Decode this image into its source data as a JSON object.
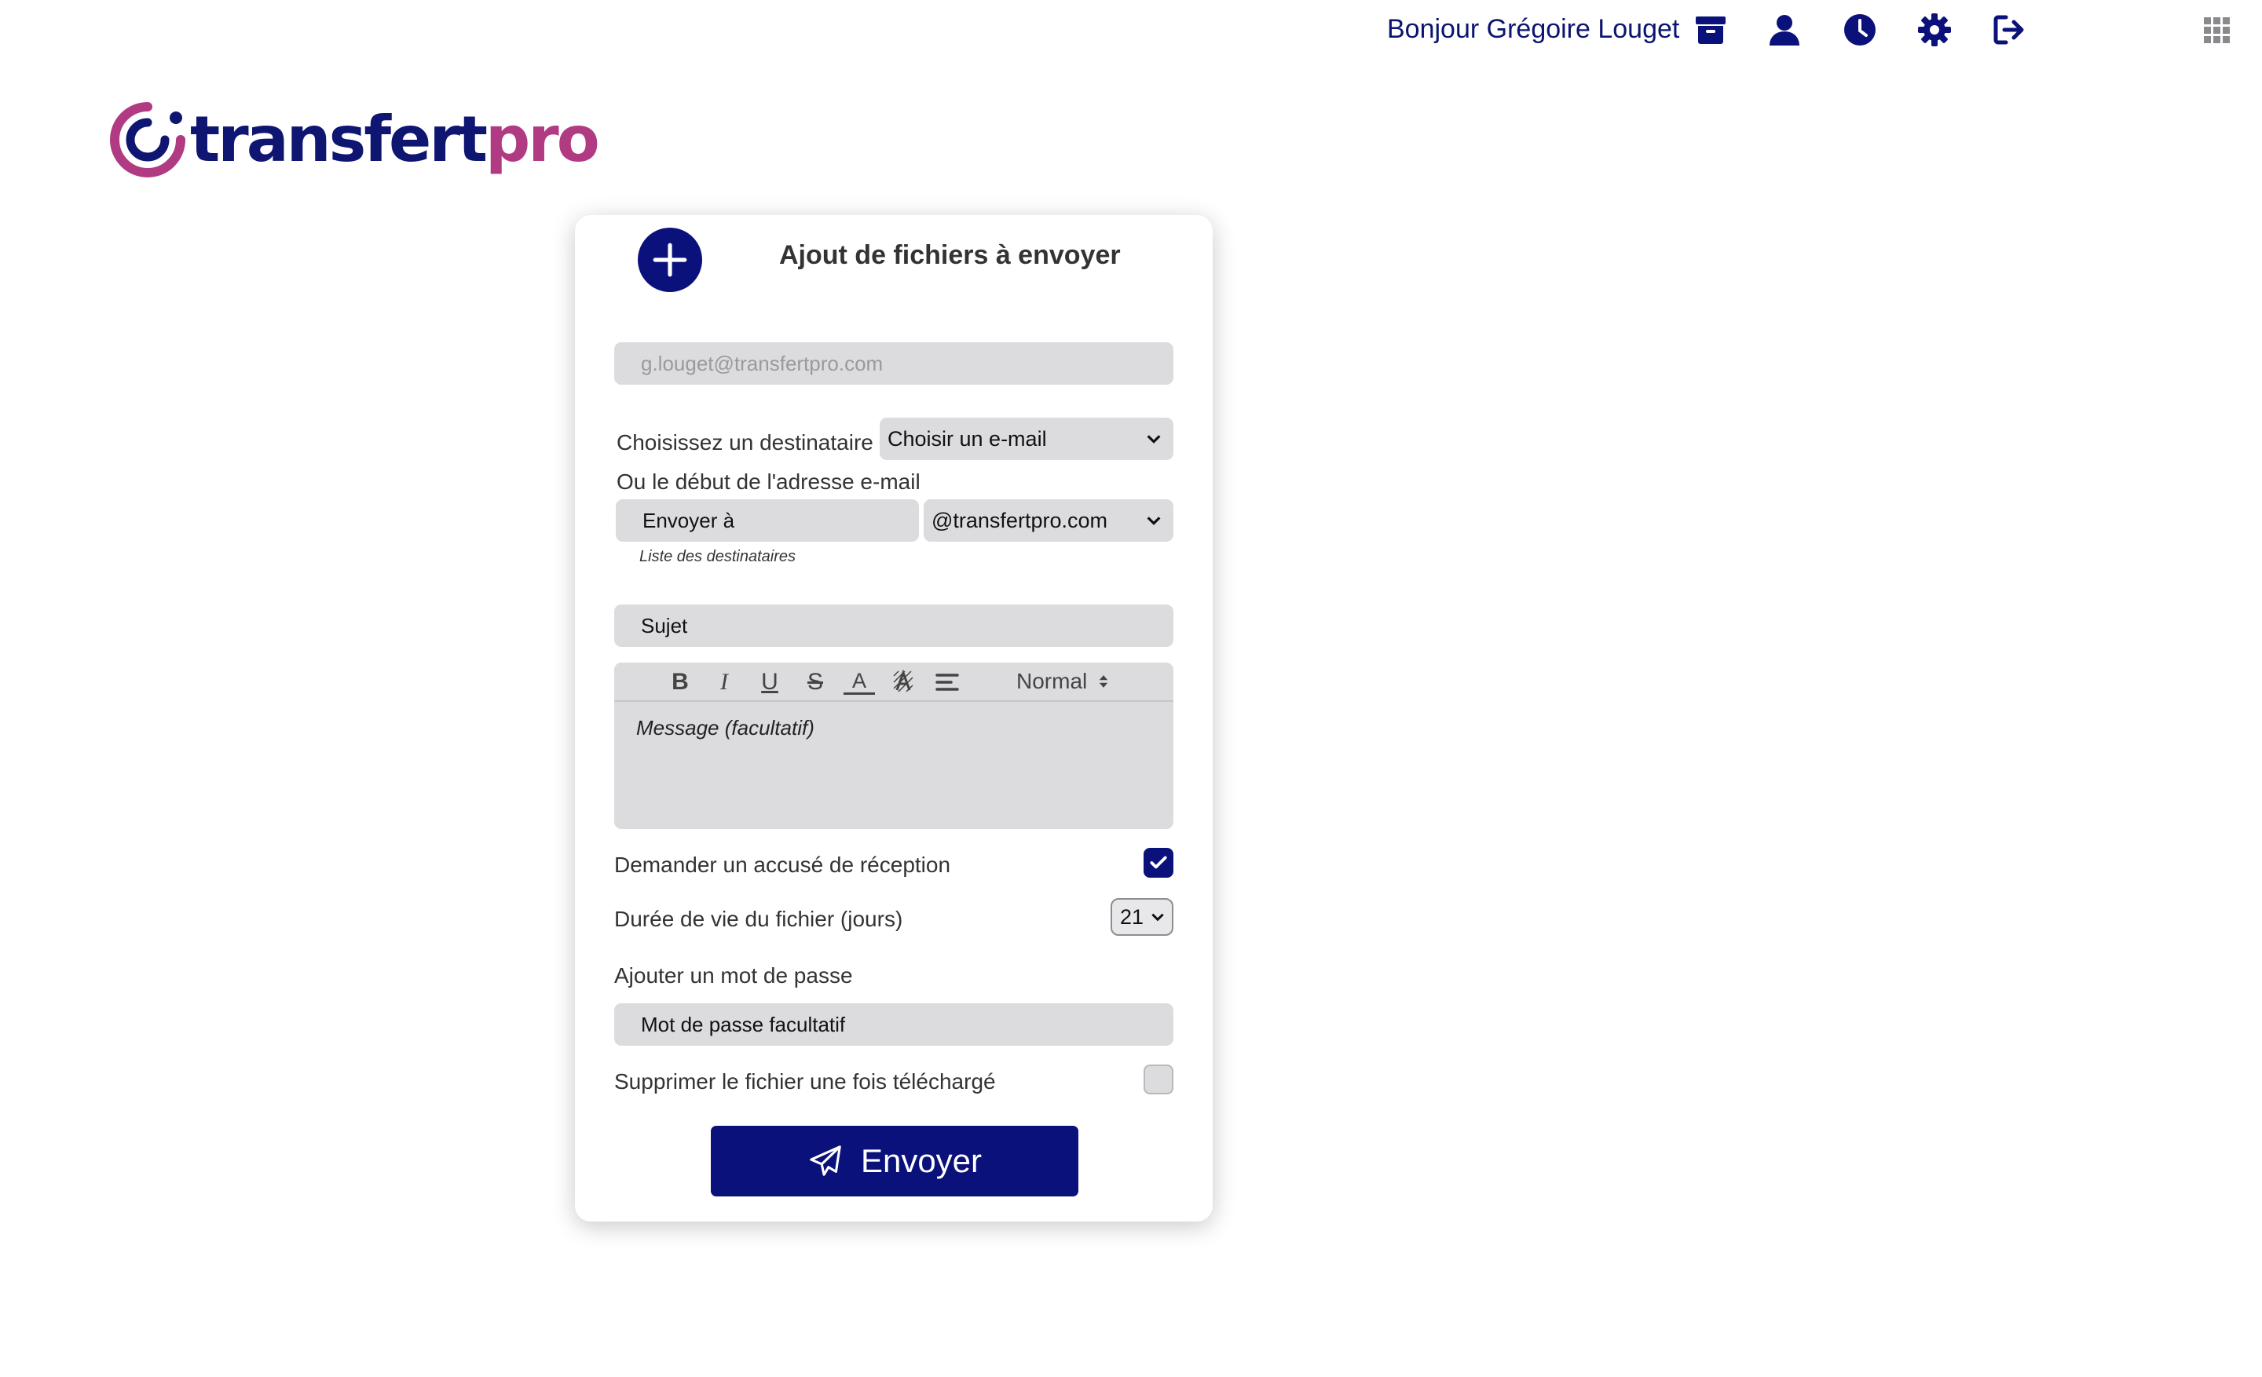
{
  "header": {
    "greeting": "Bonjour Grégoire Louget",
    "icons": [
      "archive-icon",
      "user-icon",
      "history-icon",
      "settings-icon",
      "logout-icon",
      "apps-grid-icon"
    ]
  },
  "logo": {
    "part1": "transfert",
    "part2": "pro"
  },
  "form": {
    "title": "Ajout de fichiers à envoyer",
    "sender_email": "g.louget@transfertpro.com",
    "recipient_label": "Choisissez un destinataire",
    "recipient_select": "Choisir un e-mail",
    "address_label": "Ou le début de l'adresse e-mail",
    "send_to_placeholder": "Envoyer à",
    "domain_select": "@transfertpro.com",
    "recipients_hint": "Liste des destinataires",
    "subject_placeholder": "Sujet",
    "editor": {
      "bold": "B",
      "italic": "I",
      "underline": "U",
      "strike": "S",
      "color": "A",
      "size": "Normal",
      "placeholder": "Message (facultatif)"
    },
    "receipt_label": "Demander un accusé de réception",
    "receipt_checked": true,
    "lifetime_label": "Durée de vie du fichier (jours)",
    "lifetime_value": "21",
    "password_label": "Ajouter un mot de passe",
    "password_placeholder": "Mot de passe facultatif",
    "delete_label": "Supprimer le fichier une fois téléchargé",
    "delete_checked": false,
    "send_label": "Envoyer"
  },
  "colors": {
    "primary": "#0b117a",
    "field_bg": "#dcdcdf",
    "logo_pink": "#b03b82"
  }
}
